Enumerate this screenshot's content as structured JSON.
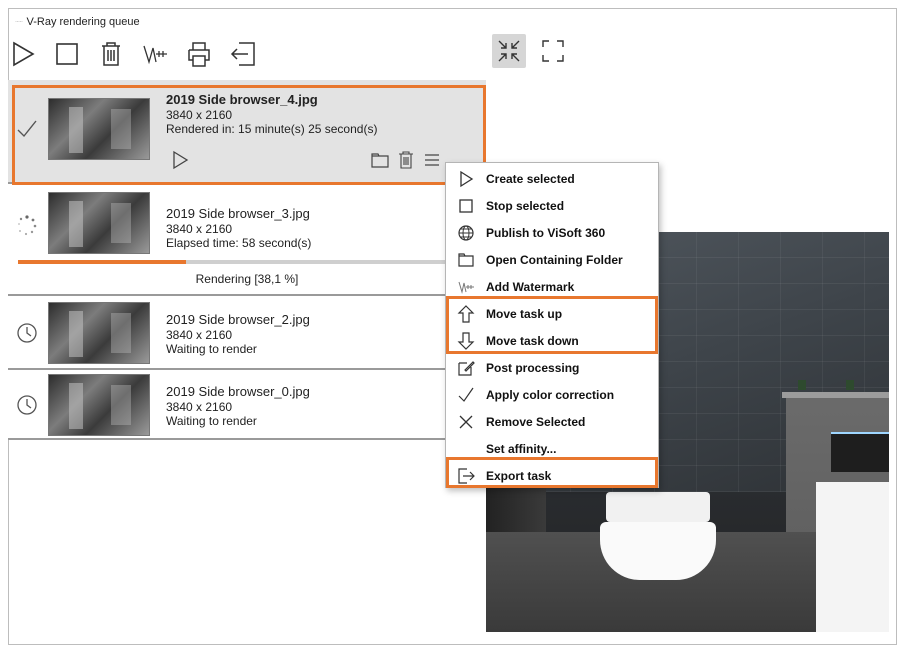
{
  "window": {
    "title": "V-Ray rendering queue",
    "app_icon_text": "·····"
  },
  "toolbar": {
    "buttons": [
      {
        "name": "start-all-button",
        "icon": "play-icon"
      },
      {
        "name": "stop-all-button",
        "icon": "stop-icon"
      },
      {
        "name": "delete-all-button",
        "icon": "trash-icon"
      },
      {
        "name": "watermark-button",
        "icon": "watermark-icon"
      },
      {
        "name": "print-button",
        "icon": "printer-icon"
      },
      {
        "name": "exit-button",
        "icon": "exit-icon"
      }
    ]
  },
  "preview_toolbar": {
    "buttons": [
      {
        "name": "fit-view-button",
        "icon": "shrink-icon",
        "active": true
      },
      {
        "name": "fullscreen-button",
        "icon": "fullscreen-icon",
        "active": false
      }
    ]
  },
  "tasks": [
    {
      "name": "2019 Side browser_4.jpg",
      "resolution": "3840 x 2160",
      "status_text": "Rendered in: 15 minute(s) 25 second(s)",
      "state": "completed",
      "status_icon": "checkmark-icon"
    },
    {
      "name": "2019 Side browser_3.jpg",
      "resolution": "3840 x 2160",
      "status_text": "Elapsed time: 58 second(s)",
      "state": "rendering",
      "status_icon": "spinner-icon",
      "progress_label": "Rendering [38,1 %]",
      "progress": 0.381
    },
    {
      "name": "2019 Side browser_2.jpg",
      "resolution": "3840 x 2160",
      "status_text": "Waiting to render",
      "state": "waiting",
      "status_icon": "clock-icon"
    },
    {
      "name": "2019 Side browser_0.jpg",
      "resolution": "3840 x 2160",
      "status_text": "Waiting to render",
      "state": "waiting",
      "status_icon": "clock-icon"
    }
  ],
  "context_menu": {
    "items": [
      {
        "label": "Create selected",
        "icon": "play-icon"
      },
      {
        "label": "Stop selected",
        "icon": "stop-icon"
      },
      {
        "label": "Publish to ViSoft 360",
        "icon": "globe-icon"
      },
      {
        "label": "Open Containing Folder",
        "icon": "folder-icon"
      },
      {
        "label": "Add Watermark",
        "icon": "watermark-icon"
      },
      {
        "label": "Move task up",
        "icon": "arrow-up-icon"
      },
      {
        "label": "Move task down",
        "icon": "arrow-down-icon"
      },
      {
        "label": "Post processing",
        "icon": "edit-icon"
      },
      {
        "label": "Apply color correction",
        "icon": "checkmark-icon"
      },
      {
        "label": "Remove Selected",
        "icon": "close-icon"
      },
      {
        "label": "Set affinity...",
        "icon": ""
      },
      {
        "label": "Export task",
        "icon": "export-icon"
      }
    ]
  },
  "colors": {
    "highlight": "#e8772e",
    "progress_fill": "#e8772e",
    "selected_bg": "#e3e3e3"
  }
}
